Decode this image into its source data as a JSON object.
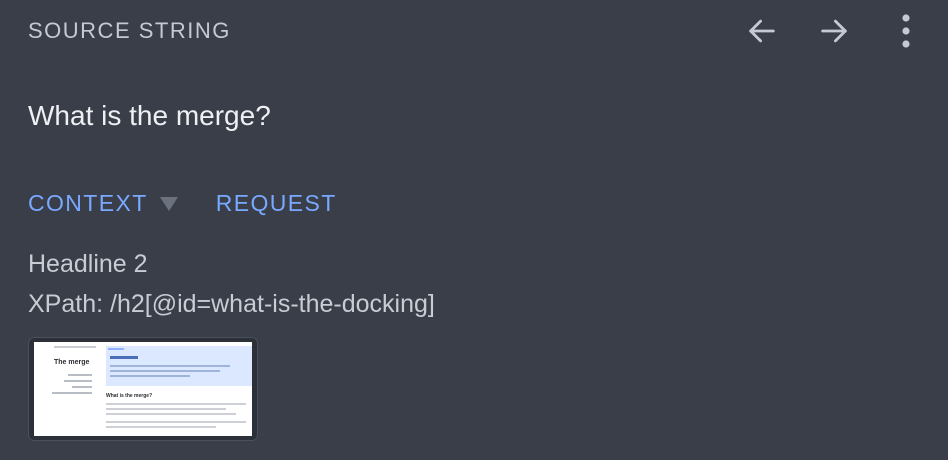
{
  "header": {
    "section_label": "SOURCE STRING",
    "icons": {
      "back": "arrow-left-icon",
      "forward": "arrow-right-icon",
      "menu": "more-vertical-icon"
    }
  },
  "source": {
    "text": "What is the merge?"
  },
  "tabs": [
    {
      "label": "CONTEXT",
      "has_dropdown": true
    },
    {
      "label": "REQUEST",
      "has_dropdown": false
    }
  ],
  "context": {
    "element_type": "Headline 2",
    "xpath": "XPath: /h2[@id=what-is-the-docking]"
  },
  "screenshot_thumbnail": {
    "sidebar_title": "The merge",
    "content_heading": "What is the merge?"
  },
  "colors": {
    "background": "#393e49",
    "accent": "#79a8ff",
    "label": "#c5c9d1",
    "text": "#eef0f3"
  }
}
